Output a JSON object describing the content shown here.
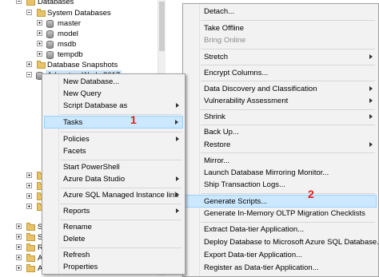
{
  "tree": {
    "databases_label": "Databases",
    "system_databases_label": "System Databases",
    "system_dbs": [
      "master",
      "model",
      "msdb",
      "tempdb"
    ],
    "snapshots_label": "Database Snapshots",
    "selected_db_label": "AdventureWorks2017",
    "partial_labels": [
      "Se",
      "Se",
      "Re",
      "Al",
      "Al"
    ]
  },
  "context_menu": {
    "items": [
      {
        "label": "New Database..."
      },
      {
        "label": "New Query"
      },
      {
        "label": "Script Database as",
        "submenu": true
      },
      {
        "label": "Tasks",
        "submenu": true,
        "highlighted": true
      },
      {
        "label": "Policies",
        "submenu": true
      },
      {
        "label": "Facets"
      },
      {
        "label": "Start PowerShell"
      },
      {
        "label": "Azure Data Studio",
        "submenu": true
      },
      {
        "label": "Azure SQL Managed Instance link",
        "submenu": true
      },
      {
        "label": "Reports",
        "submenu": true
      },
      {
        "label": "Rename"
      },
      {
        "label": "Delete"
      },
      {
        "label": "Refresh"
      },
      {
        "label": "Properties"
      }
    ],
    "step_marker": "1"
  },
  "tasks_menu": {
    "items": [
      {
        "label": "Detach..."
      },
      {
        "label": "Take Offline"
      },
      {
        "label": "Bring Online",
        "disabled": true
      },
      {
        "label": "Stretch",
        "submenu": true
      },
      {
        "label": "Encrypt Columns..."
      },
      {
        "label": "Data Discovery and Classification",
        "submenu": true
      },
      {
        "label": "Vulnerability Assessment",
        "submenu": true
      },
      {
        "label": "Shrink",
        "submenu": true
      },
      {
        "label": "Back Up..."
      },
      {
        "label": "Restore",
        "submenu": true
      },
      {
        "label": "Mirror..."
      },
      {
        "label": "Launch Database Mirroring Monitor..."
      },
      {
        "label": "Ship Transaction Logs..."
      },
      {
        "label": "Generate Scripts...",
        "highlighted": true
      },
      {
        "label": "Generate In-Memory OLTP Migration Checklists"
      },
      {
        "label": "Extract Data-tier Application..."
      },
      {
        "label": "Deploy Database to Microsoft Azure SQL Database..."
      },
      {
        "label": "Export Data-tier Application..."
      },
      {
        "label": "Register as Data-tier Application..."
      }
    ],
    "step_marker": "2"
  },
  "colors": {
    "highlight": "#cce8ff",
    "step_marker": "#e0201a"
  }
}
